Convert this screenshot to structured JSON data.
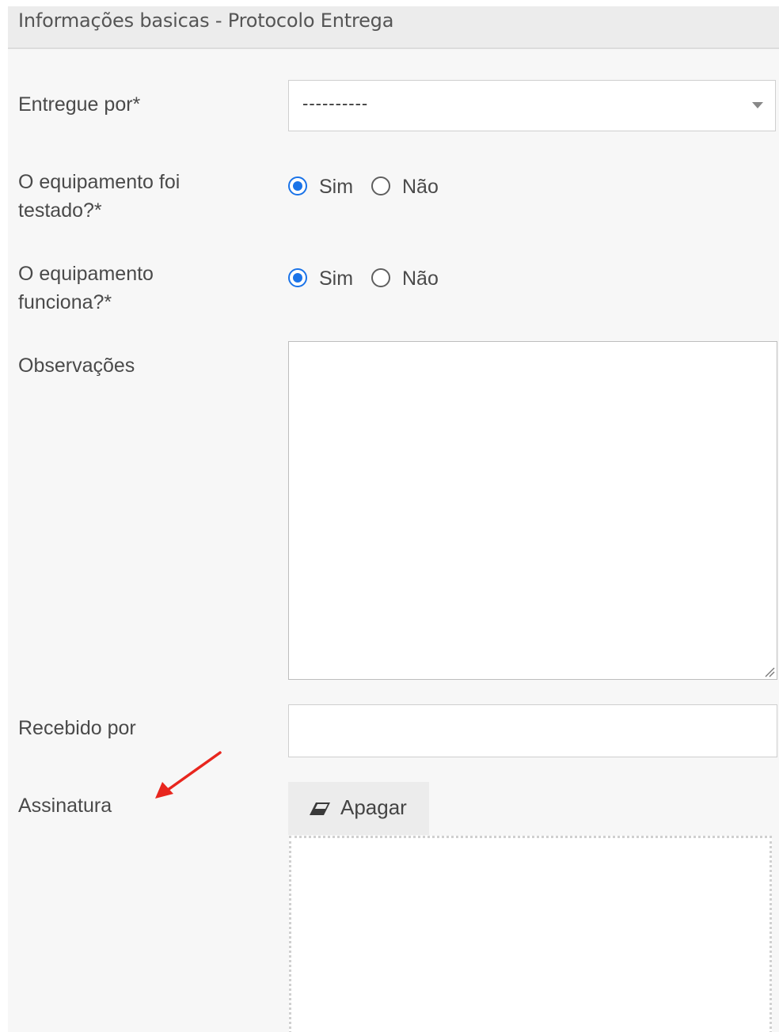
{
  "panel": {
    "title": "Informações basicas - Protocolo Entrega"
  },
  "fields": {
    "entregue_por": {
      "label": "Entregue por*",
      "value": "----------"
    },
    "testado": {
      "label_line1": "O equipamento foi",
      "label_line2": "testado?*",
      "options": [
        "Sim",
        "Não"
      ],
      "selected": "Sim"
    },
    "funciona": {
      "label_line1": "O equipamento",
      "label_line2": "funciona?*",
      "options": [
        "Sim",
        "Não"
      ],
      "selected": "Sim"
    },
    "observacoes": {
      "label": "Observações",
      "value": ""
    },
    "recebido_por": {
      "label": "Recebido por",
      "value": ""
    },
    "assinatura": {
      "label": "Assinatura",
      "erase_label": "Apagar"
    }
  },
  "icons": {
    "erase": "eraser-icon",
    "caret": "chevron-down-icon",
    "annotation": "arrow-icon"
  },
  "colors": {
    "accent": "#1a73e8",
    "annotation_arrow": "#e8261e",
    "header_bg": "#ececec",
    "panel_bg": "#f7f7f7"
  }
}
